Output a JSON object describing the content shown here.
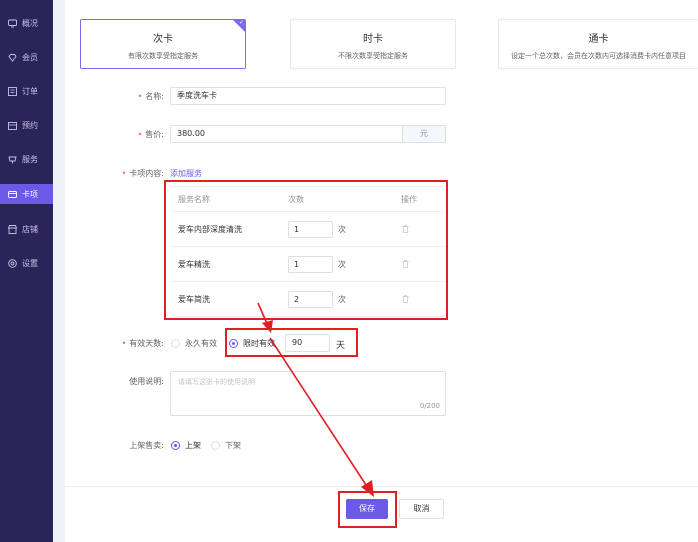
{
  "sidebar": {
    "items": [
      {
        "label": "概况",
        "icon": "monitor-icon"
      },
      {
        "label": "会员",
        "icon": "diamond-icon"
      },
      {
        "label": "订单",
        "icon": "list-icon"
      },
      {
        "label": "预约",
        "icon": "calendar-icon"
      },
      {
        "label": "服务",
        "icon": "service-icon"
      },
      {
        "label": "卡项",
        "icon": "card-icon",
        "active": true
      },
      {
        "label": "店铺",
        "icon": "shop-icon"
      },
      {
        "label": "设置",
        "icon": "settings-icon"
      }
    ]
  },
  "card_types": [
    {
      "title": "次卡",
      "desc": "有限次数享受指定服务",
      "selected": true
    },
    {
      "title": "时卡",
      "desc": "不限次数享受指定服务",
      "selected": false
    },
    {
      "title": "通卡",
      "desc": "设定一个总次数，会员在次数内可选择消费卡内任意项目",
      "selected": false
    }
  ],
  "form": {
    "name_label": "名称:",
    "name_value": "季度洗车卡",
    "price_label": "售价:",
    "price_value": "380.00",
    "price_unit": "元",
    "content_label": "卡项内容:",
    "add_service_link": "添加服务",
    "table": {
      "headers": {
        "name": "服务名称",
        "count": "次数",
        "action": "操作"
      },
      "rows": [
        {
          "name": "爱车内部深度清洗",
          "count": "1",
          "unit": "次"
        },
        {
          "name": "爱车精洗",
          "count": "1",
          "unit": "次"
        },
        {
          "name": "爱车简洗",
          "count": "2",
          "unit": "次"
        }
      ]
    },
    "validity_label": "有效天数:",
    "validity_permanent": "永久有效",
    "validity_limited": "限时有效",
    "validity_days": "90",
    "validity_unit": "天",
    "usage_label": "使用说明:",
    "usage_placeholder": "请填写这张卡的使用说明",
    "usage_counter": "0/200",
    "shelf_label": "上架售卖:",
    "shelf_on": "上架",
    "shelf_off": "下架"
  },
  "footer": {
    "save_label": "保存",
    "cancel_label": "取消"
  },
  "colors": {
    "accent": "#6b59e8",
    "sidebar": "#2b2458",
    "annotation": "#e02020"
  }
}
